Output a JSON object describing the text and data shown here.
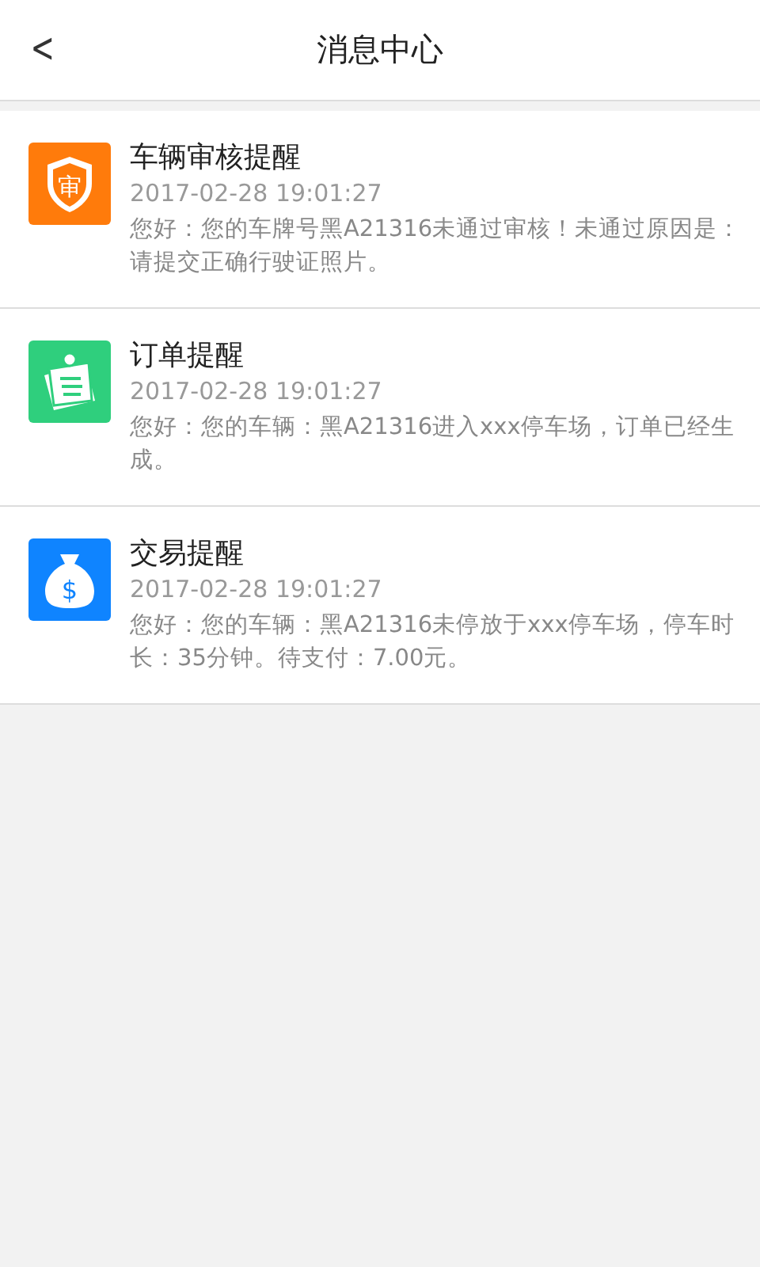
{
  "header": {
    "back": "<",
    "title": "消息中心"
  },
  "messages": [
    {
      "kind": "review",
      "icon_text": "审",
      "title": "车辆审核提醒",
      "time": "2017-02-28 19:01:27",
      "body": "您好：您的车牌号黑A21316未通过审核！未通过原因是：请提交正确行驶证照片。"
    },
    {
      "kind": "order",
      "title": "订单提醒",
      "time": "2017-02-28 19:01:27",
      "body": "您好：您的车辆：黑A21316进入xxx停车场，订单已经生成。"
    },
    {
      "kind": "payment",
      "icon_text": "$",
      "title": "交易提醒",
      "time": "2017-02-28 19:01:27",
      "body": "您好：您的车辆：黑A21316未停放于xxx停车场，停车时长：35分钟。待支付：7.00元。"
    }
  ]
}
